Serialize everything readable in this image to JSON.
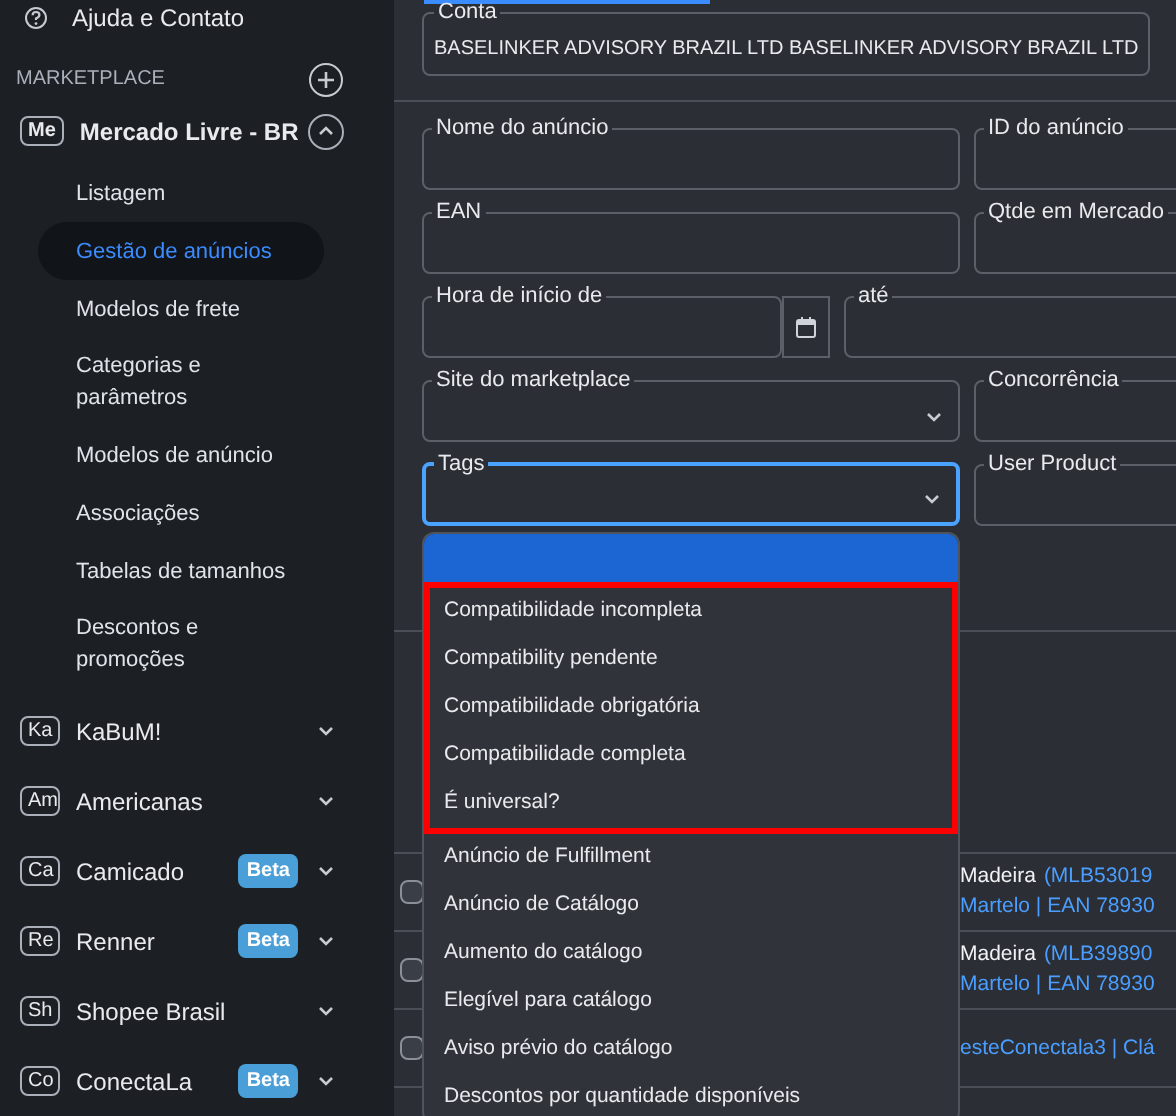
{
  "sidebar": {
    "help": {
      "label": "Ajuda e Contato"
    },
    "section": {
      "title": "MARKETPLACE"
    },
    "current": {
      "badge": "Me",
      "name": "Mercado Livre - BR",
      "expanded": true,
      "items": [
        {
          "label": "Listagem",
          "selected": false
        },
        {
          "label": "Gestão de anúncios",
          "selected": true
        },
        {
          "label": "Modelos de frete",
          "selected": false
        },
        {
          "label": "Categorias e parâmetros",
          "selected": false
        },
        {
          "label": "Modelos de anúncio",
          "selected": false
        },
        {
          "label": "Associações",
          "selected": false
        },
        {
          "label": "Tabelas de tamanhos",
          "selected": false
        },
        {
          "label": "Descontos e promoções",
          "selected": false
        }
      ]
    },
    "marketplaces": [
      {
        "badge": "Ka",
        "name": "KaBuM!"
      },
      {
        "badge": "Am",
        "name": "Americanas"
      },
      {
        "badge": "Ca",
        "name": "Camicado",
        "tag": "Beta"
      },
      {
        "badge": "Re",
        "name": "Renner",
        "tag": "Beta"
      },
      {
        "badge": "Sh",
        "name": "Shopee Brasil"
      },
      {
        "badge": "Co",
        "name": "ConectaLa",
        "tag": "Beta"
      }
    ]
  },
  "account": {
    "label": "Conta",
    "value": "BASELINKER ADVISORY BRAZIL LTD BASELINKER ADVISORY BRAZIL LTD"
  },
  "filters": [
    {
      "kind": "text",
      "label": "Nome do anúncio"
    },
    {
      "kind": "text",
      "label": "ID do anúncio"
    },
    {
      "kind": "text",
      "label": "EAN"
    },
    {
      "kind": "text",
      "label": "Qtde em Mercado"
    },
    {
      "kind": "date",
      "label": "Hora de início de"
    },
    {
      "kind": "text",
      "label": "até"
    },
    {
      "kind": "select",
      "label": "Site do marketplace"
    },
    {
      "kind": "text",
      "label": "Concorrência"
    },
    {
      "kind": "select",
      "label": "Tags",
      "focused": true
    },
    {
      "kind": "text",
      "label": "User Product"
    }
  ],
  "tags_dropdown": {
    "blank_option_selected": true,
    "options": [
      {
        "label": "Compatibilidade incompleta",
        "outlined": true
      },
      {
        "label": "Compatibility pendente",
        "outlined": true
      },
      {
        "label": "Compatibilidade obrigatória",
        "outlined": true
      },
      {
        "label": "Compatibilidade completa",
        "outlined": true
      },
      {
        "label": "É universal?",
        "outlined": true
      },
      {
        "label": "Anúncio de Fulfillment",
        "outlined": false
      },
      {
        "label": "Anúncio de Catálogo",
        "outlined": false
      },
      {
        "label": "Aumento do catálogo",
        "outlined": false
      },
      {
        "label": "Elegível para catálogo",
        "outlined": false
      },
      {
        "label": "Aviso prévio do catálogo",
        "outlined": false
      },
      {
        "label": "Descontos por quantidade disponíveis",
        "outlined": false
      }
    ]
  },
  "listings": [
    {
      "checked": false,
      "title": "Madeira",
      "id": "(MLB53019",
      "details": "Martelo | EAN 78930"
    },
    {
      "checked": false,
      "title": "Madeira",
      "id": "(MLB39890",
      "details": "Martelo | EAN 78930"
    },
    {
      "checked": false,
      "details": "esteConectala3 | Clá"
    }
  ]
}
